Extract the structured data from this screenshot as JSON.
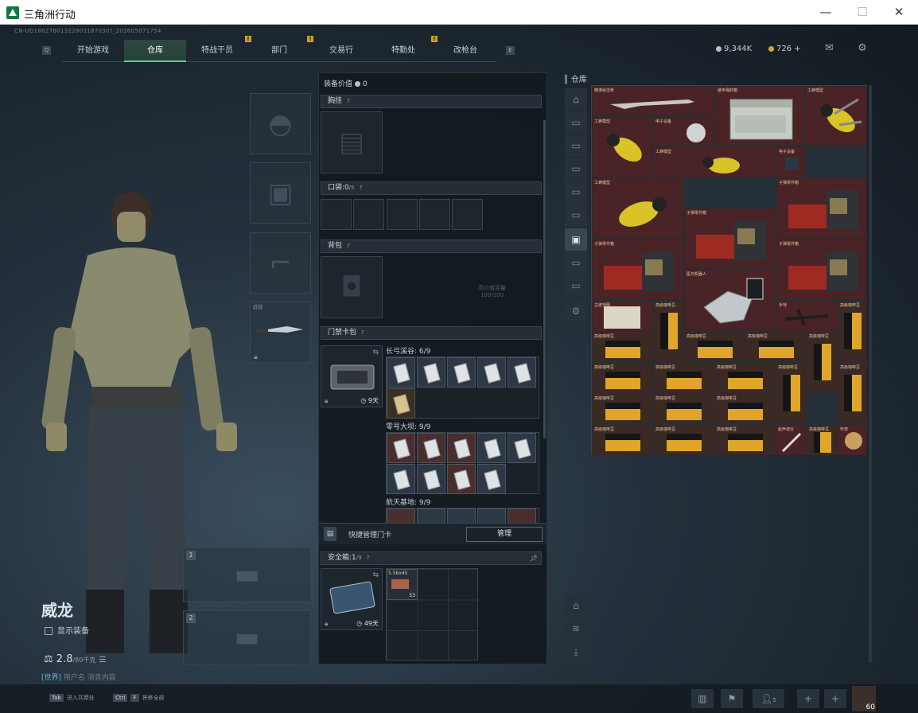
{
  "window": {
    "title": "三角洲行动",
    "min": "—",
    "max": "☐",
    "close": "✕"
  },
  "uid": "CN-UD18627601322803187030?_202605071754",
  "nav": {
    "q_key": "Q",
    "e_key": "E",
    "tabs": [
      {
        "label": "开始游戏"
      },
      {
        "label": "仓库",
        "active": true
      },
      {
        "label": "特战干员",
        "alert": "!"
      },
      {
        "label": "部门",
        "alert": "!"
      },
      {
        "label": "交易行"
      },
      {
        "label": "特勤处",
        "alert": "!"
      },
      {
        "label": "改枪台"
      }
    ]
  },
  "currency": {
    "silver": "9,344K",
    "gold": "726 +",
    "silver_color": "#b9c0c6",
    "gold_color": "#d6a43c"
  },
  "character": {
    "name": "威龙",
    "show_equipment": "显示装备",
    "weight": "2.8",
    "weight_max": "/80千克",
    "chat_channel": "[世界]",
    "chat_text": "用户名 消息内容"
  },
  "slots": {
    "melee_label": "近战",
    "weapon1": "1",
    "weapon2": "2"
  },
  "bottom": {
    "hint1_key": "Tab",
    "hint1": "进入共聚处",
    "hint2_key": "Ctrl",
    "hint2": "将移全部",
    "friends": "5",
    "avatar_level": "60"
  },
  "equip": {
    "value_label": "装备价值",
    "value": "0",
    "chest_label": "胸挂",
    "pocket_label": "口袋:",
    "pocket_count": "0",
    "pocket_max": "/5",
    "backpack_label": "背包",
    "backpack_hint": "高价值容量",
    "backpack_cap": "100/100",
    "keycard_label": "门禁卡包",
    "keycard_days": "9天",
    "groups": [
      {
        "name": "长弓溪谷: 6/9"
      },
      {
        "name": "零号大坝: 9/9"
      },
      {
        "name": "航天基地: 9/9"
      }
    ],
    "quick_manage": "快捷管理门卡",
    "manage_btn": "管理",
    "safebox_label": "安全箱:",
    "safebox_count": "1",
    "safebox_max": "/9",
    "safebox_days": "49天",
    "ammo_name": "5.56x45",
    "ammo_count": "53"
  },
  "warehouse": {
    "title": "仓库",
    "items": [
      {
        "name": "精准射击枪"
      },
      {
        "name": "装甲弹药箱"
      },
      {
        "name": "工蜂模型"
      },
      {
        "name": "电子设备"
      },
      {
        "name": "子弹零件箱"
      },
      {
        "name": "医疗机器人"
      },
      {
        "name": "古老地图"
      },
      {
        "name": "高级咖啡豆"
      },
      {
        "name": "手弩"
      },
      {
        "name": "起声波仪"
      },
      {
        "name": "怀表"
      }
    ]
  }
}
